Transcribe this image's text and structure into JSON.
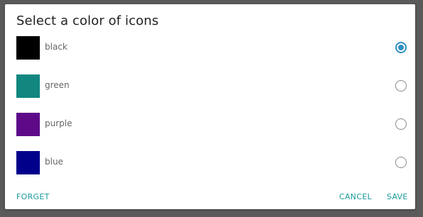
{
  "dialog": {
    "title": "Select a color of icons",
    "options": [
      {
        "label": "black",
        "color": "#000000",
        "selected": true
      },
      {
        "label": "green",
        "color": "#12877f",
        "selected": false
      },
      {
        "label": "purple",
        "color": "#5e0a88",
        "selected": false
      },
      {
        "label": "blue",
        "color": "#00008b",
        "selected": false
      }
    ],
    "buttons": {
      "forget": "FORGET",
      "cancel": "CANCEL",
      "save": "SAVE"
    }
  },
  "colors": {
    "accent": "#2f8fc6",
    "button_text": "#1a9a9a",
    "backdrop": "#5a5a5a"
  }
}
